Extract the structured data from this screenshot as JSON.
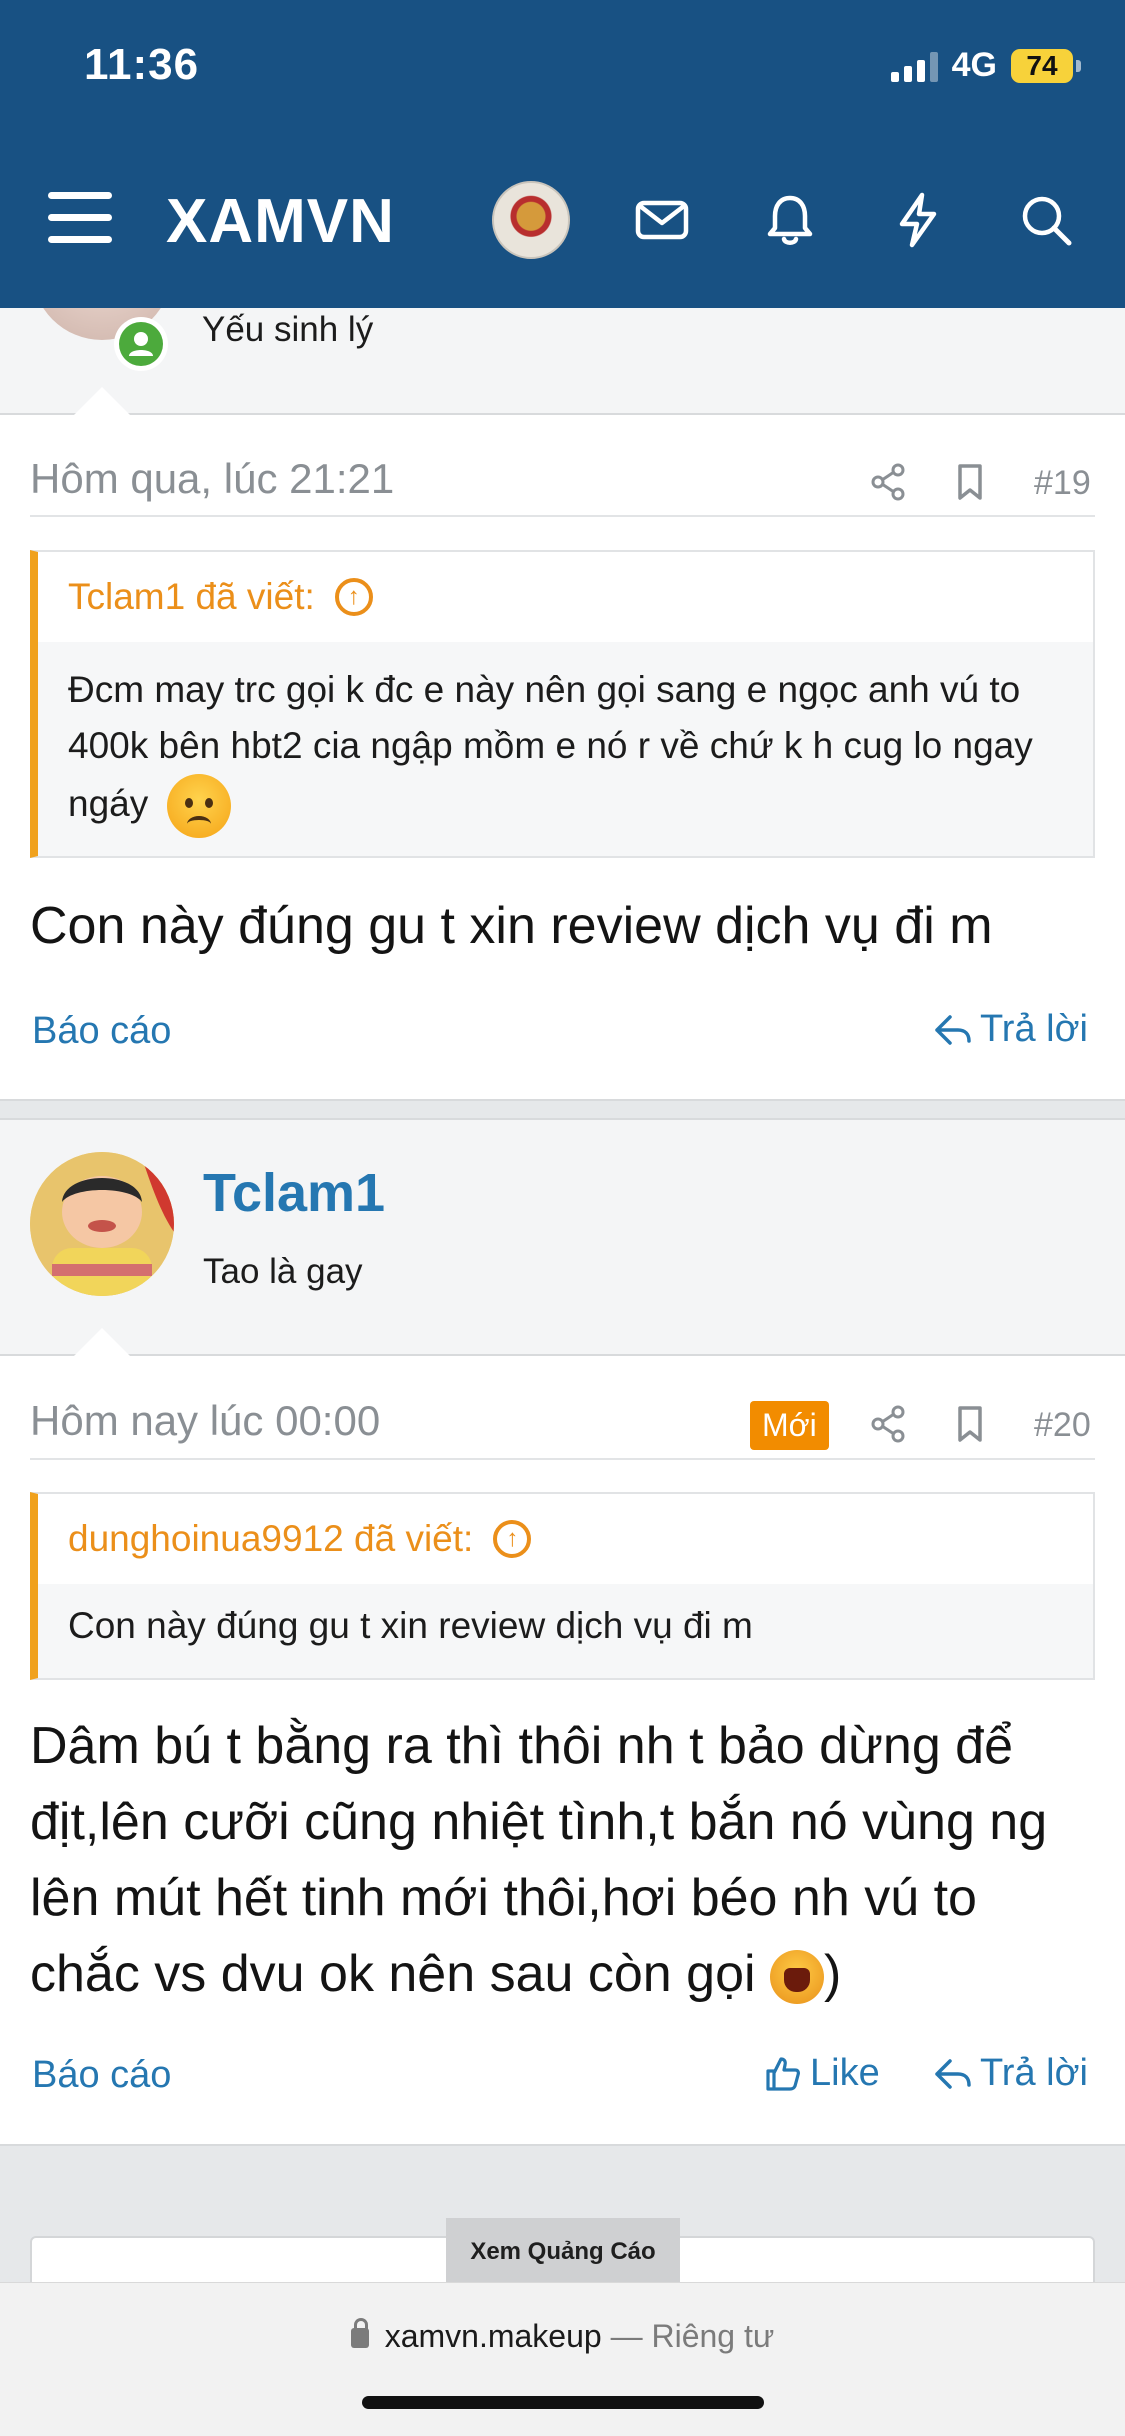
{
  "status": {
    "time": "11:36",
    "network": "4G",
    "battery": "74"
  },
  "header": {
    "brand": "XAMVN"
  },
  "post19": {
    "user_title": "Yếu sinh lý",
    "time": "Hôm qua, lúc 21:21",
    "number": "#19",
    "quote_author": "Tclam1 đã viết:",
    "quote_text": "Đcm may trc gọi k đc e này nên gọi sang e ngọc anh vú to 400k bên hbt2 cia ngập mồm e nó r về chứ k h cug lo ngay ngáy",
    "body": "Con này đúng gu t xin review dịch vụ đi m",
    "report": "Báo cáo",
    "reply": "Trả lời"
  },
  "post20": {
    "username": "Tclam1",
    "user_title": "Tao là gay",
    "time": "Hôm nay lúc 00:00",
    "badge": "Mới",
    "number": "#20",
    "quote_author": "dunghoinua9912 đã viết:",
    "quote_text": "Con này đúng gu t xin review dịch vụ đi m",
    "body": "Dâm bú t bằng ra thì thôi nh t bảo dừng để địt,lên cưỡi cũng nhiệt tình,t bắn nó vùng ng lên mút hết tinh mới thôi,hơi béo nh vú to chắc vs dvu ok nên sau còn gọi",
    "body_tail": ")",
    "report": "Báo cáo",
    "like": "Like",
    "reply": "Trả lời"
  },
  "ad": {
    "label": "Xem Quảng Cáo"
  },
  "browser": {
    "domain": "xamvn.makeup",
    "separator": "—",
    "privacy": "Riêng tư"
  }
}
